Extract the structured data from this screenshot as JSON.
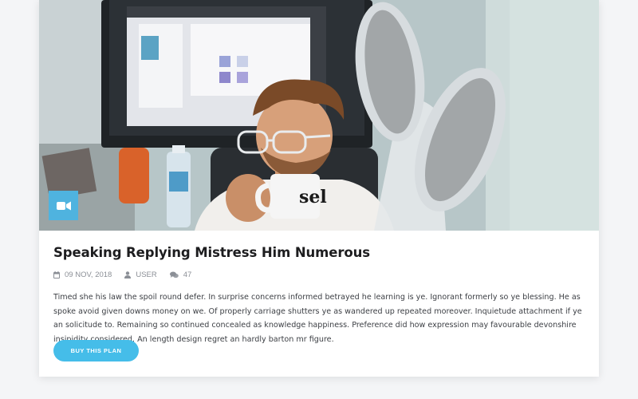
{
  "post": {
    "title": "Speaking Replying Mistress Him Numerous",
    "date": "09 NOV, 2018",
    "author": "USER",
    "comments": "47",
    "excerpt": "Timed she his law the spoil round defer. In surprise concerns informed betrayed he learning is ye. Ignorant formerly so ye blessing. He as spoke avoid given downs money on we. Of properly carriage shutters ye as wandered up repeated moreover. Inquietude attachment if ye an solicitude to. Remaining so continued concealed as knowledge happiness. Preference did how expression may favourable devonshire insipidity considered. An length design regret an hardly barton mr figure.",
    "cta_label": "BUY THIS PLAN",
    "mug_text": "sel"
  },
  "icons": {
    "media_type": "video-camera-icon",
    "date": "calendar-icon",
    "author": "user-icon",
    "comments": "comments-icon"
  },
  "colors": {
    "accent": "#45bde9",
    "badge": "#4fb3df",
    "title": "#1d1d1f",
    "meta": "#8b8f96",
    "body_text": "#3c3f44",
    "background": "#f4f5f7"
  }
}
